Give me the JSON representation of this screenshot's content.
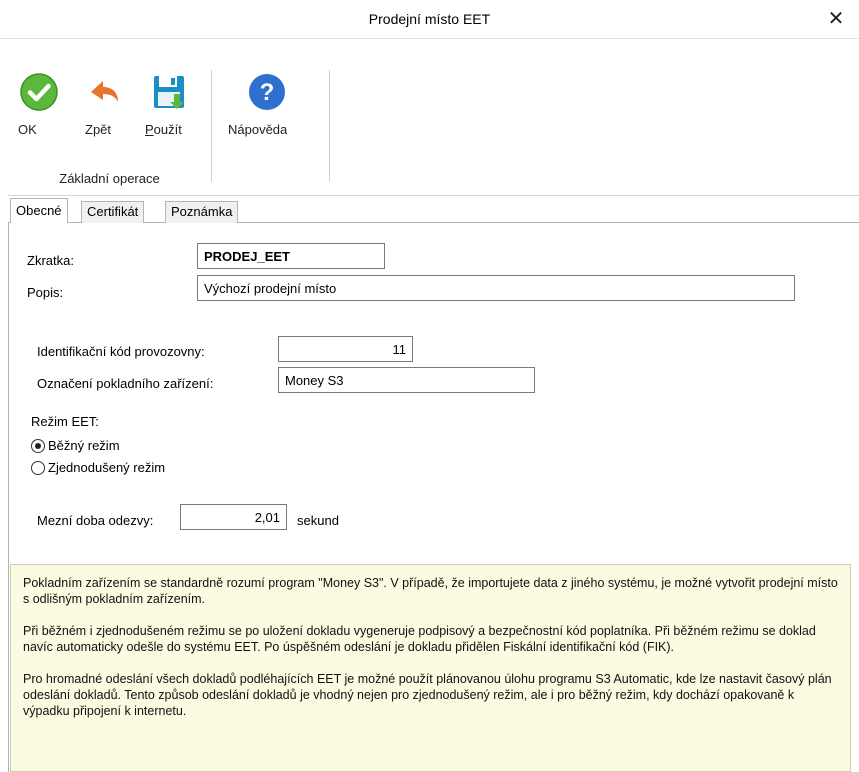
{
  "window": {
    "title": "Prodejní místo EET",
    "close_symbol": "✕"
  },
  "ribbon": {
    "buttons": [
      {
        "label": "OK"
      },
      {
        "label": "Zpět"
      },
      {
        "label_accel": "P",
        "label_rest": "oužít"
      },
      {
        "label": "Nápověda"
      }
    ],
    "group_label": "Základní operace"
  },
  "tabs": [
    {
      "label": "Obecné"
    },
    {
      "label": "Certifikát"
    },
    {
      "label": "Poznámka"
    }
  ],
  "form": {
    "zkratka": {
      "label": "Zkratka:",
      "value": "PRODEJ_EET"
    },
    "popis": {
      "label": "Popis:",
      "value": "Výchozí prodejní místo"
    },
    "kod": {
      "label": "Identifikační kód provozovny:",
      "value": "11"
    },
    "pokladna": {
      "label": "Označení pokladního zařízení:",
      "value": "Money S3"
    },
    "rezim": {
      "label": "Režim EET:",
      "options": [
        {
          "label": "Běžný režim",
          "selected": true
        },
        {
          "label": "Zjednodušený režim",
          "selected": false
        }
      ]
    },
    "doba": {
      "label": "Mezní doba odezvy:",
      "value": "2,01",
      "unit": "sekund"
    }
  },
  "info": {
    "paragraphs": [
      "Pokladním zařízením se standardně rozumí program \"Money S3\". V případě, že importujete data z jiného systému, je možné vytvořit prodejní místo s odlišným pokladním zařízením.",
      "Při běžném i zjednodušeném režimu se po uložení dokladu vygeneruje podpisový a bezpečnostní kód poplatníka. Při běžném režimu se doklad navíc automaticky odešle do systému EET. Po úspěšném odeslání je dokladu přidělen Fiskální identifikační kód (FIK).",
      "Pro hromadné odeslání všech dokladů podléhajících EET je možné použít plánovanou úlohu programu S3 Automatic, kde lze nastavit časový plán odeslání dokladů. Tento způsob odeslání dokladů je vhodný nejen pro zjednodušený režim, ale i pro běžný režim, kdy dochází opakovaně k výpadku připojení k internetu."
    ]
  },
  "colors": {
    "ok_green": "#5cb83a",
    "back_orange": "#e8742a",
    "save_teal": "#1c8fc2",
    "help_blue": "#2f6fcf",
    "info_bg": "#fbfbe2"
  }
}
